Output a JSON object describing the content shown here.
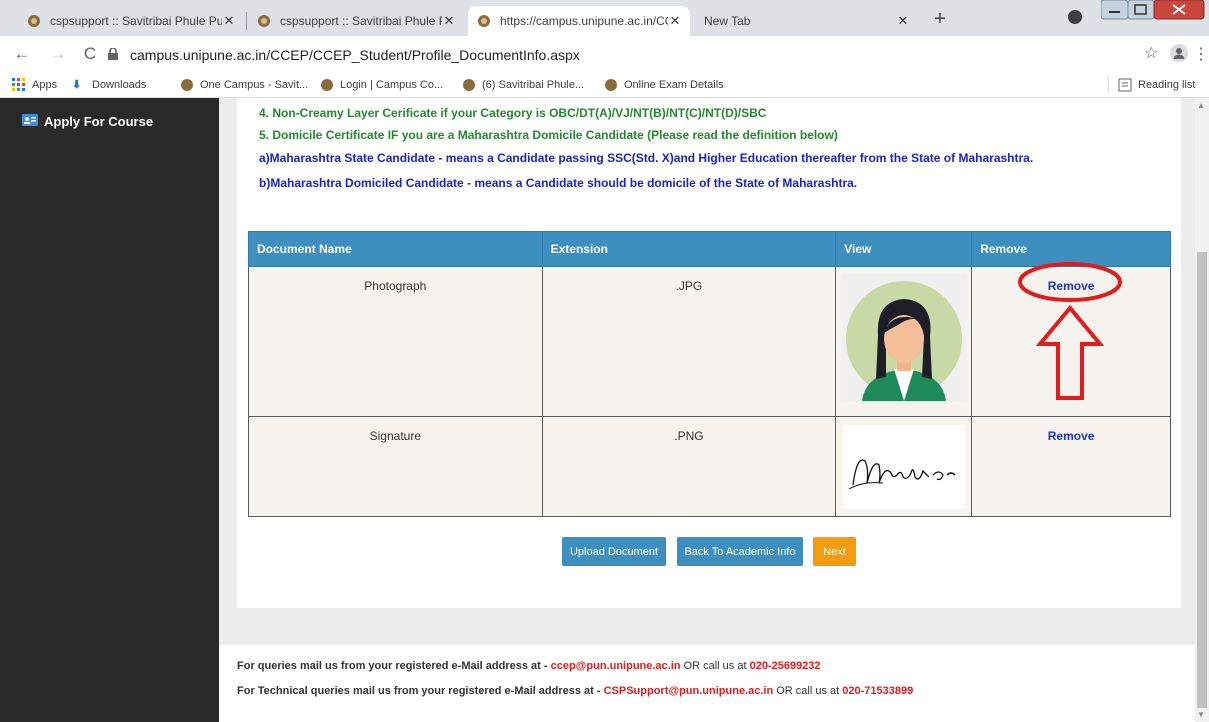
{
  "browser": {
    "tabs": [
      {
        "title": "cspsupport :: Savitribai Phule Pun",
        "active": false
      },
      {
        "title": "cspsupport :: Savitribai Phule Pun",
        "active": false
      },
      {
        "title": "https://campus.unipune.ac.in/CC",
        "active": true
      },
      {
        "title": "New Tab",
        "active": false
      }
    ],
    "url": "campus.unipune.ac.in/CCEP/CCEP_Student/Profile_DocumentInfo.aspx",
    "bookmarks": [
      "Apps",
      "Downloads",
      "One Campus - Savit...",
      "Login | Campus Co...",
      "(6) Savitribai Phule...",
      "Online Exam Details"
    ],
    "reading_list": "Reading list"
  },
  "sidebar": {
    "items": [
      {
        "label": "Apply For Course",
        "icon": "id-card-icon"
      }
    ]
  },
  "notes": [
    {
      "text": "4. Non-Creamy Layer Cerificate if your Category is OBC/DT(A)/VJ/NT(B)/NT(C)/NT(D)/SBC",
      "color": "#26892f"
    },
    {
      "text": "5. Domicile Certificate IF you are a Maharashtra Domicile Candidate (Please read the definition below)",
      "color": "#26892f"
    },
    {
      "text": "a)Maharashtra State Candidate - means a Candidate passing SSC(Std. X)and Higher Education thereafter from the State of Maharashtra.",
      "color": "#1a22d6"
    },
    {
      "text": "b)Maharashtra Domiciled Candidate - means a Candidate should be domicile of the State of Maharashtra.",
      "color": "#1a22d6"
    }
  ],
  "table": {
    "headers": [
      "Document Name",
      "Extension",
      "View",
      "Remove"
    ],
    "rows": [
      {
        "name": "Photograph",
        "ext": ".JPG",
        "remove": "Remove"
      },
      {
        "name": "Signature",
        "ext": ".PNG",
        "remove": "Remove"
      }
    ]
  },
  "buttons": {
    "upload": "Upload Document",
    "back": "Back To Academic Info",
    "next": "Next"
  },
  "footer": {
    "line1_prefix": "For queries mail us from your registered e-Mail address at - ",
    "line1_email": "ccep@pun.unipune.ac.in",
    "line1_mid": " OR call us at ",
    "line1_phone": "020-25699232",
    "line2_prefix": "For Technical queries mail us from your registered e-Mail address at - ",
    "line2_email": "CSPSupport@pun.unipune.ac.in",
    "line2_mid": " OR call us at ",
    "line2_phone": "020-71533899"
  },
  "colors": {
    "header_blue": "#3d8fbf",
    "annotation_red": "#e21b1b",
    "next_orange": "#f39c12"
  }
}
